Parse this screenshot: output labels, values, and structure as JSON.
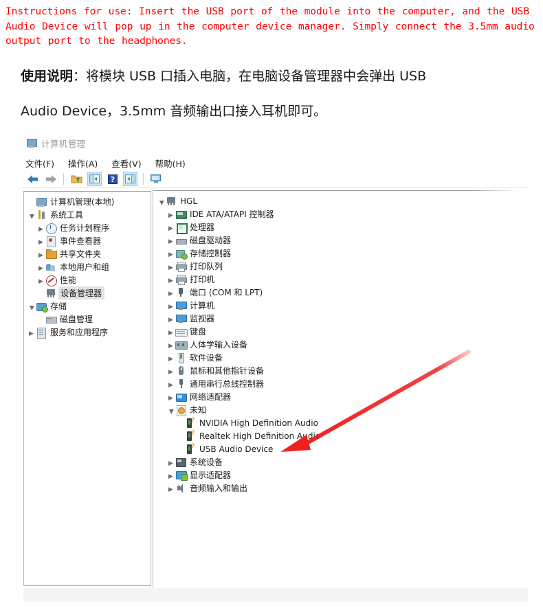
{
  "instructions": {
    "en_text": "Instructions for use: Insert the USB port of the module into the computer, and the USB Audio Device will pop up in the computer device manager. Simply connect the 3.5mm audio output port to the headphones.",
    "cn_line1": "使用说明：将模块 USB 口插入电脑，在电脑设备管理器中会弹出 USB",
    "cn_line2": "Audio Device，3.5mm 音频输出口接入耳机即可。",
    "cn_bold_prefix": "使用说明",
    "accent_color": "#ff0000"
  },
  "window": {
    "title": "计算机管理",
    "title_icon": "computer-management-icon",
    "menus": [
      {
        "label": "文件(F)",
        "name": "menu-file"
      },
      {
        "label": "操作(A)",
        "name": "menu-action"
      },
      {
        "label": "查看(V)",
        "name": "menu-view"
      },
      {
        "label": "帮助(H)",
        "name": "menu-help"
      }
    ],
    "toolbar": [
      {
        "name": "back-arrow-icon",
        "glyph": "←",
        "color": "#2e7dc4",
        "selected": false
      },
      {
        "name": "forward-arrow-icon",
        "glyph": "→",
        "color": "#9aa3aa",
        "selected": false
      },
      {
        "name": "separator-1",
        "glyph": "",
        "color": "",
        "selected": false
      },
      {
        "name": "up-folder-icon",
        "glyph": "",
        "color": "#e3a33a",
        "selected": false
      },
      {
        "name": "show-hide-console-tree-icon",
        "glyph": "",
        "color": "#3a8fd0",
        "selected": true
      },
      {
        "name": "help-icon",
        "glyph": "?",
        "color": "#1d4ea8",
        "selected": false
      },
      {
        "name": "show-action-pane-icon",
        "glyph": "",
        "color": "#3a8fd0",
        "selected": true
      },
      {
        "name": "separator-2",
        "glyph": "",
        "color": "",
        "selected": false
      },
      {
        "name": "monitor-icon",
        "glyph": "",
        "color": "#4a9fd8",
        "selected": false
      }
    ]
  },
  "left_tree": [
    {
      "label": "计算机管理(本地)",
      "indent": 0,
      "expander": "none",
      "icon": "computer-management-icon",
      "selected": false
    },
    {
      "label": "系统工具",
      "indent": 0,
      "expander": "open",
      "icon": "system-tools-icon",
      "selected": false
    },
    {
      "label": "任务计划程序",
      "indent": 1,
      "expander": "closed",
      "icon": "task-scheduler-icon",
      "selected": false
    },
    {
      "label": "事件查看器",
      "indent": 1,
      "expander": "closed",
      "icon": "event-viewer-icon",
      "selected": false
    },
    {
      "label": "共享文件夹",
      "indent": 1,
      "expander": "closed",
      "icon": "shared-folders-icon",
      "selected": false
    },
    {
      "label": "本地用户和组",
      "indent": 1,
      "expander": "closed",
      "icon": "local-users-groups-icon",
      "selected": false
    },
    {
      "label": "性能",
      "indent": 1,
      "expander": "closed",
      "icon": "performance-icon",
      "selected": false
    },
    {
      "label": "设备管理器",
      "indent": 1,
      "expander": "none",
      "icon": "device-manager-icon",
      "selected": true
    },
    {
      "label": "存储",
      "indent": 0,
      "expander": "open",
      "icon": "storage-icon",
      "selected": false
    },
    {
      "label": "磁盘管理",
      "indent": 1,
      "expander": "none",
      "icon": "disk-management-icon",
      "selected": false
    },
    {
      "label": "服务和应用程序",
      "indent": 0,
      "expander": "closed",
      "icon": "services-applications-icon",
      "selected": false
    }
  ],
  "right_tree": [
    {
      "label": "HGL",
      "indent": 0,
      "expander": "open",
      "icon": "computer-node-icon"
    },
    {
      "label": "IDE ATA/ATAPI 控制器",
      "indent": 1,
      "expander": "closed",
      "icon": "ide-controller-icon"
    },
    {
      "label": "处理器",
      "indent": 1,
      "expander": "closed",
      "icon": "processor-icon"
    },
    {
      "label": "磁盘驱动器",
      "indent": 1,
      "expander": "closed",
      "icon": "disk-drive-icon"
    },
    {
      "label": "存储控制器",
      "indent": 1,
      "expander": "closed",
      "icon": "storage-controller-icon"
    },
    {
      "label": "打印队列",
      "indent": 1,
      "expander": "closed",
      "icon": "print-queue-icon"
    },
    {
      "label": "打印机",
      "indent": 1,
      "expander": "closed",
      "icon": "printer-icon"
    },
    {
      "label": "端口 (COM 和 LPT)",
      "indent": 1,
      "expander": "closed",
      "icon": "ports-icon"
    },
    {
      "label": "计算机",
      "indent": 1,
      "expander": "closed",
      "icon": "computer-icon"
    },
    {
      "label": "监视器",
      "indent": 1,
      "expander": "closed",
      "icon": "monitor-icon"
    },
    {
      "label": "键盘",
      "indent": 1,
      "expander": "closed",
      "icon": "keyboard-icon"
    },
    {
      "label": "人体学输入设备",
      "indent": 1,
      "expander": "closed",
      "icon": "hid-icon"
    },
    {
      "label": "软件设备",
      "indent": 1,
      "expander": "closed",
      "icon": "software-device-icon"
    },
    {
      "label": "鼠标和其他指针设备",
      "indent": 1,
      "expander": "closed",
      "icon": "mouse-icon"
    },
    {
      "label": "通用串行总线控制器",
      "indent": 1,
      "expander": "closed",
      "icon": "usb-controller-icon"
    },
    {
      "label": "网络适配器",
      "indent": 1,
      "expander": "closed",
      "icon": "network-adapter-icon"
    },
    {
      "label": "未知",
      "indent": 1,
      "expander": "open",
      "icon": "unknown-devices-icon"
    },
    {
      "label": "NVIDIA High Definition Audio",
      "indent": 2,
      "expander": "none",
      "icon": "unknown-device-question-icon"
    },
    {
      "label": "Realtek High Definition Audio",
      "indent": 2,
      "expander": "none",
      "icon": "unknown-device-question-icon"
    },
    {
      "label": "USB Audio Device",
      "indent": 2,
      "expander": "none",
      "icon": "unknown-device-question-icon"
    },
    {
      "label": "系统设备",
      "indent": 1,
      "expander": "closed",
      "icon": "system-devices-icon"
    },
    {
      "label": "显示适配器",
      "indent": 1,
      "expander": "closed",
      "icon": "display-adapter-icon"
    },
    {
      "label": "音频输入和输出",
      "indent": 1,
      "expander": "closed",
      "icon": "audio-io-icon"
    }
  ],
  "annotation": {
    "arrow_name": "red-callout-arrow",
    "arrow_color": "#ef2020",
    "points_to": "USB Audio Device"
  }
}
